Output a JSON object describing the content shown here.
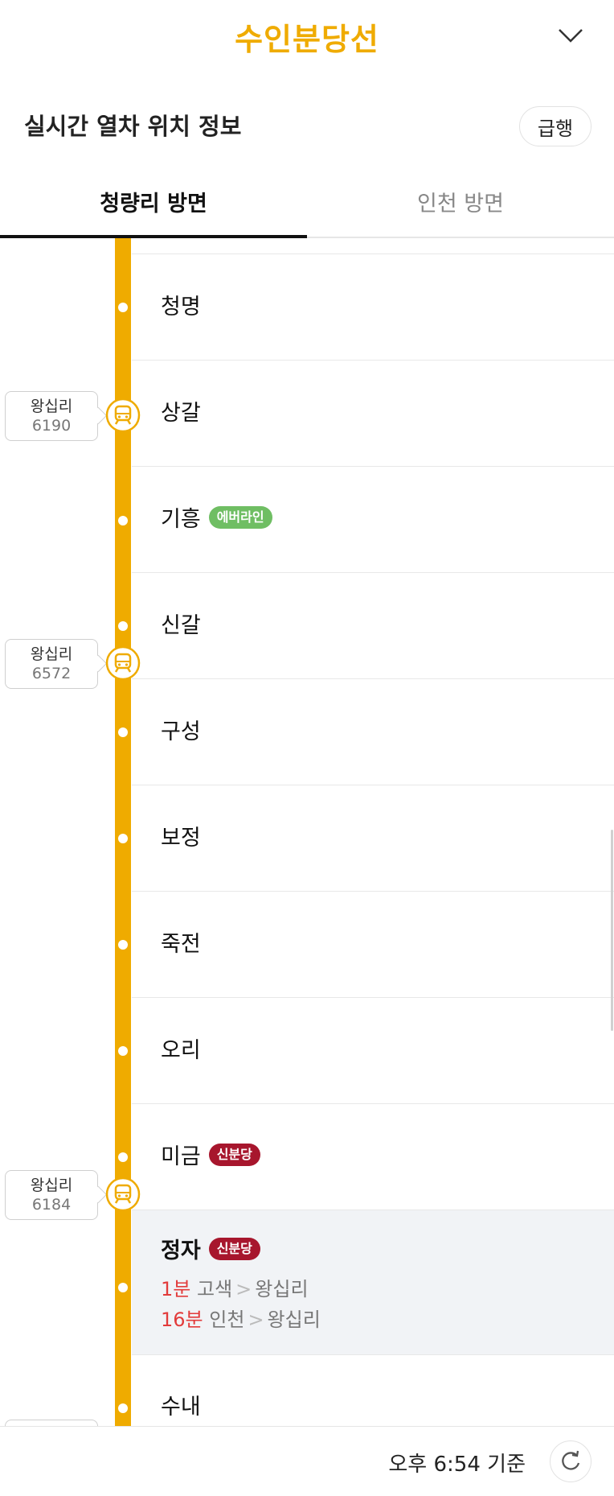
{
  "header": {
    "title": "수인분당선"
  },
  "subheader": {
    "label": "실시간 열차 위치 정보",
    "express_button": "급행"
  },
  "tabs": [
    {
      "label": "청량리 방면",
      "active": true
    },
    {
      "label": "인천 방면",
      "active": false
    }
  ],
  "stations": [
    {
      "name": "청명"
    },
    {
      "name": "상갈"
    },
    {
      "name": "기흥",
      "transfer": "에버라인",
      "transfer_color": "#6fbe63"
    },
    {
      "name": "신갈"
    },
    {
      "name": "구성"
    },
    {
      "name": "보정"
    },
    {
      "name": "죽전"
    },
    {
      "name": "오리"
    },
    {
      "name": "미금",
      "transfer": "신분당",
      "transfer_color": "#a7162d"
    },
    {
      "name": "정자",
      "transfer": "신분당",
      "transfer_color": "#a7162d",
      "highlighted": true,
      "arrivals": [
        {
          "minutes": "1분",
          "origin": "고색",
          "destination": "왕십리"
        },
        {
          "minutes": "16분",
          "origin": "인천",
          "destination": "왕십리"
        }
      ]
    },
    {
      "name": "수내"
    }
  ],
  "trains": [
    {
      "destination": "왕십리",
      "number": "6190"
    },
    {
      "destination": "왕십리",
      "number": "6572"
    },
    {
      "destination": "왕십리",
      "number": "6184"
    }
  ],
  "footer": {
    "timestamp": "오후 6:54 기준"
  },
  "colors": {
    "line": "#EFAB00",
    "accent_red": "#e23b3b"
  },
  "icons": [
    "chevron-down-icon",
    "train-icon",
    "refresh-icon"
  ]
}
